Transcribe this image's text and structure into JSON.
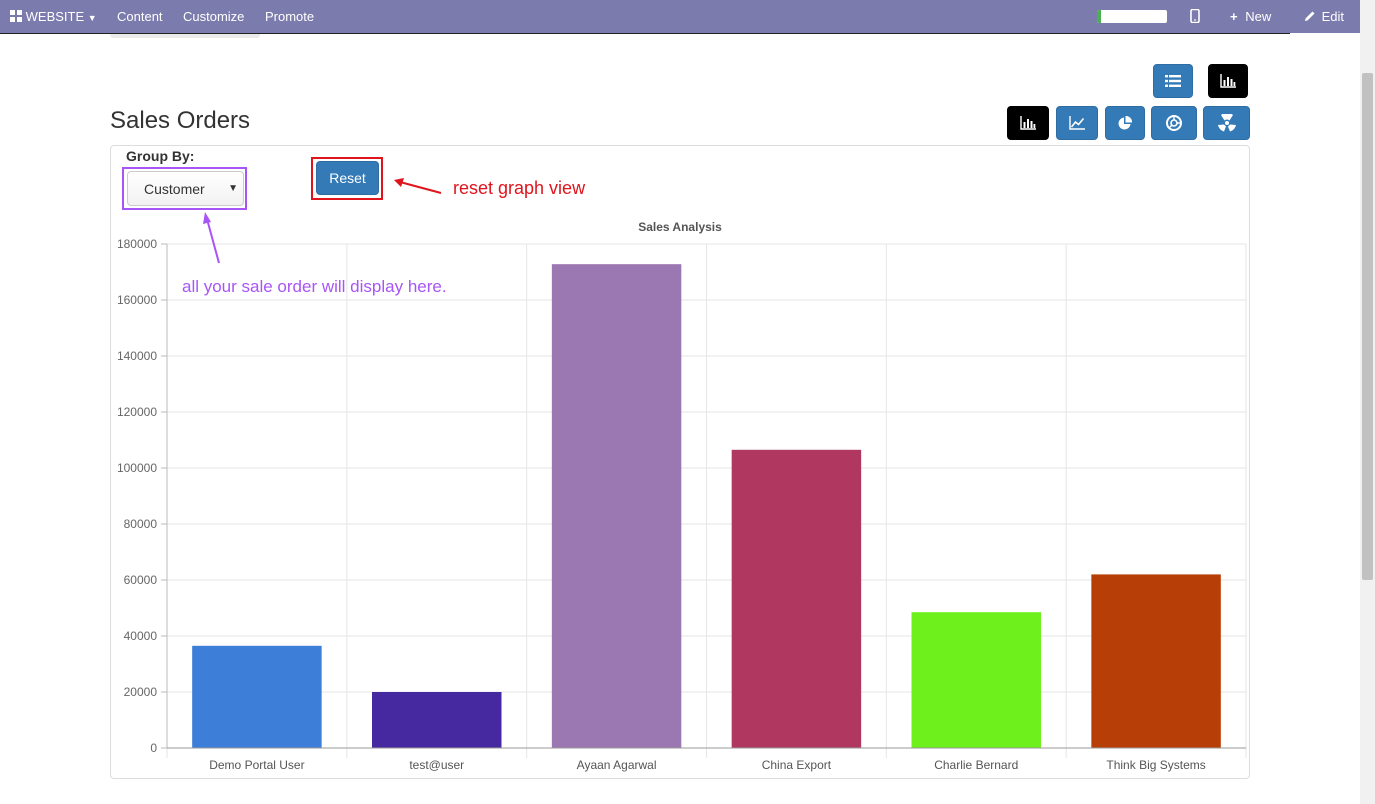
{
  "navbar": {
    "website_label": "WEBSITE",
    "menu": [
      "Content",
      "Customize",
      "Promote"
    ],
    "new_label": "New",
    "edit_label": "Edit",
    "progress_fraction": 0.06,
    "colors": {
      "bar": "#7c7bad",
      "progress_fill": "#4caf50"
    }
  },
  "page": {
    "title": "Sales Orders",
    "group_by_label": "Group By:",
    "group_by_value": "Customer",
    "reset_label": "Reset"
  },
  "view_buttons": {
    "top": [
      {
        "icon": "list-icon",
        "active": false
      },
      {
        "icon": "bar-chart-icon",
        "active": true
      }
    ],
    "chart_types": [
      {
        "icon": "bar-chart-icon",
        "active": true
      },
      {
        "icon": "line-chart-icon",
        "active": false
      },
      {
        "icon": "pie-chart-icon",
        "active": false
      },
      {
        "icon": "doughnut-chart-icon",
        "active": false
      },
      {
        "icon": "polar-area-chart-icon",
        "active": false
      }
    ]
  },
  "annotations": {
    "reset_note": "reset graph view",
    "groupby_note": "all your sale order will display here.",
    "colors": {
      "reset": "#e0141c",
      "groupby": "#a855f7"
    }
  },
  "chart_data": {
    "type": "bar",
    "title": "Sales Analysis",
    "categories": [
      "Demo Portal User",
      "test@user",
      "Ayaan Agarwal",
      "China Export",
      "Charlie Bernard",
      "Think Big Systems"
    ],
    "values": [
      36500,
      20000,
      172800,
      106500,
      48500,
      62000
    ],
    "colors": [
      "#3d7fd8",
      "#4628a0",
      "#9c78b3",
      "#b0375f",
      "#6df01c",
      "#b83e08"
    ],
    "ylim": [
      0,
      180000
    ],
    "yticks": [
      "0",
      "20000",
      "40000",
      "60000",
      "80000",
      "100000",
      "120000",
      "140000",
      "160000",
      "180000"
    ],
    "grid": true,
    "legend": "none"
  }
}
